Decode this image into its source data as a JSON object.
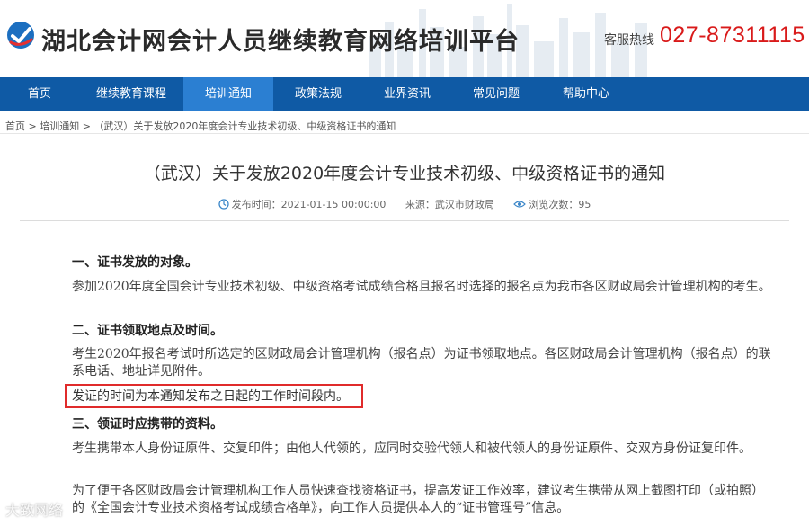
{
  "header": {
    "site_title": "湖北会计网会计人员继续教育网络培训平台",
    "hotline_label": "客服热线",
    "hotline_number": "027-87311115"
  },
  "nav": {
    "items": [
      "首页",
      "继续教育课程",
      "培训通知",
      "政策法规",
      "业界资讯",
      "常见问题",
      "帮助中心"
    ],
    "active_index": 2
  },
  "breadcrumb": {
    "home": "首页",
    "sep": ">",
    "section": "培训通知",
    "current": "（武汉）关于发放2020年度会计专业技术初级、中级资格证书的通知"
  },
  "article": {
    "title": "（武汉）关于发放2020年度会计专业技术初级、中级资格证书的通知",
    "publish_label": "发布时间：",
    "publish_time": "2021-01-15 00:00:00",
    "source_label": "来源：",
    "source": "武汉市财政局",
    "views_label": "浏览次数：",
    "views": "95",
    "sections": [
      {
        "heading": "一、证书发放的对象。",
        "paragraphs": [
          "参加2020年度全国会计专业技术初级、中级资格考试成绩合格且报名时选择的报名点为我市各区财政局会计管理机构的考生。"
        ]
      },
      {
        "heading": "二、证书领取地点及时间。",
        "paragraphs": [
          "考生2020年报名考试时所选定的区财政局会计管理机构（报名点）为证书领取地点。各区财政局会计管理机构（报名点）的联系电话、地址详见附件。",
          "发证的时间为本通知发布之日起的工作时间段内。"
        ]
      },
      {
        "heading": "三、领证时应携带的资料。",
        "paragraphs": [
          "考生携带本人身份证原件、交复印件；由他人代领的，应同时交验代领人和被代领人的身份证原件、交双方身份证复印件。",
          "为了便于各区财政局会计管理机构工作人员快速查找资格证书，提高发证工作效率，建议考生携带从网上截图打印（或拍照）的《全国会计专业技术资格考试成绩合格单》，向工作人员提供本人的“证书管理号”信息。"
        ]
      }
    ]
  },
  "watermark": "大致网络",
  "colors": {
    "nav_bg": "#0f5aa5",
    "nav_active": "#2b7fd2",
    "hotline": "#d91a1a",
    "highlight_border": "#e02b2b"
  }
}
